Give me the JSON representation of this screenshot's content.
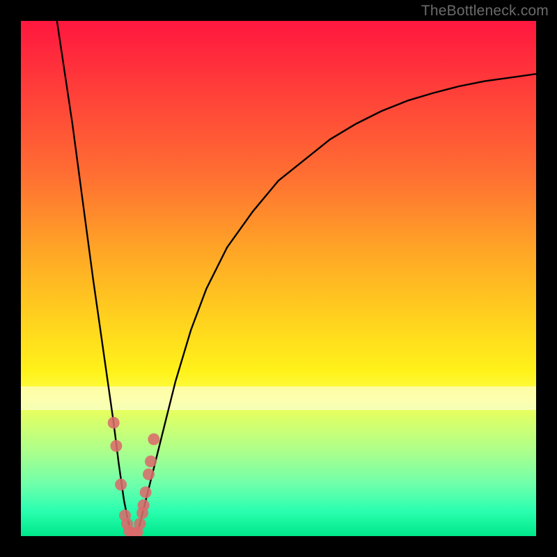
{
  "watermark": "TheBottleneck.com",
  "chart_data": {
    "type": "line",
    "title": "",
    "xlabel": "",
    "ylabel": "",
    "xlim": [
      0,
      100
    ],
    "ylim": [
      0,
      100
    ],
    "grid": false,
    "series": [
      {
        "name": "bottleneck-curve",
        "x": [
          7,
          10,
          12,
          14,
          16,
          18,
          19,
          20,
          21,
          22,
          23,
          24,
          26,
          28,
          30,
          33,
          36,
          40,
          45,
          50,
          55,
          60,
          65,
          70,
          75,
          80,
          85,
          90,
          95,
          100
        ],
        "values": [
          100,
          80,
          65,
          50,
          36,
          22,
          14,
          7,
          2,
          0,
          2,
          6,
          14,
          22,
          30,
          40,
          48,
          56,
          63,
          69,
          73,
          77,
          80,
          82.5,
          84.5,
          86,
          87.3,
          88.3,
          89,
          89.7
        ]
      }
    ],
    "markers": {
      "name": "highlight-points",
      "color": "#db6b6b",
      "x": [
        18.0,
        18.5,
        19.4,
        20.2,
        20.6,
        21.0,
        21.8,
        22.2,
        22.6,
        23.1,
        23.6,
        23.8,
        24.2,
        24.8,
        25.2,
        25.8
      ],
      "values": [
        22.0,
        17.5,
        10.0,
        4.0,
        2.4,
        1.0,
        0.5,
        0.4,
        0.8,
        2.4,
        4.5,
        6.0,
        8.5,
        12.0,
        14.5,
        18.8
      ]
    },
    "bands": [
      {
        "y0": 24.5,
        "y1": 29.0,
        "opacity": 0.55
      }
    ]
  }
}
